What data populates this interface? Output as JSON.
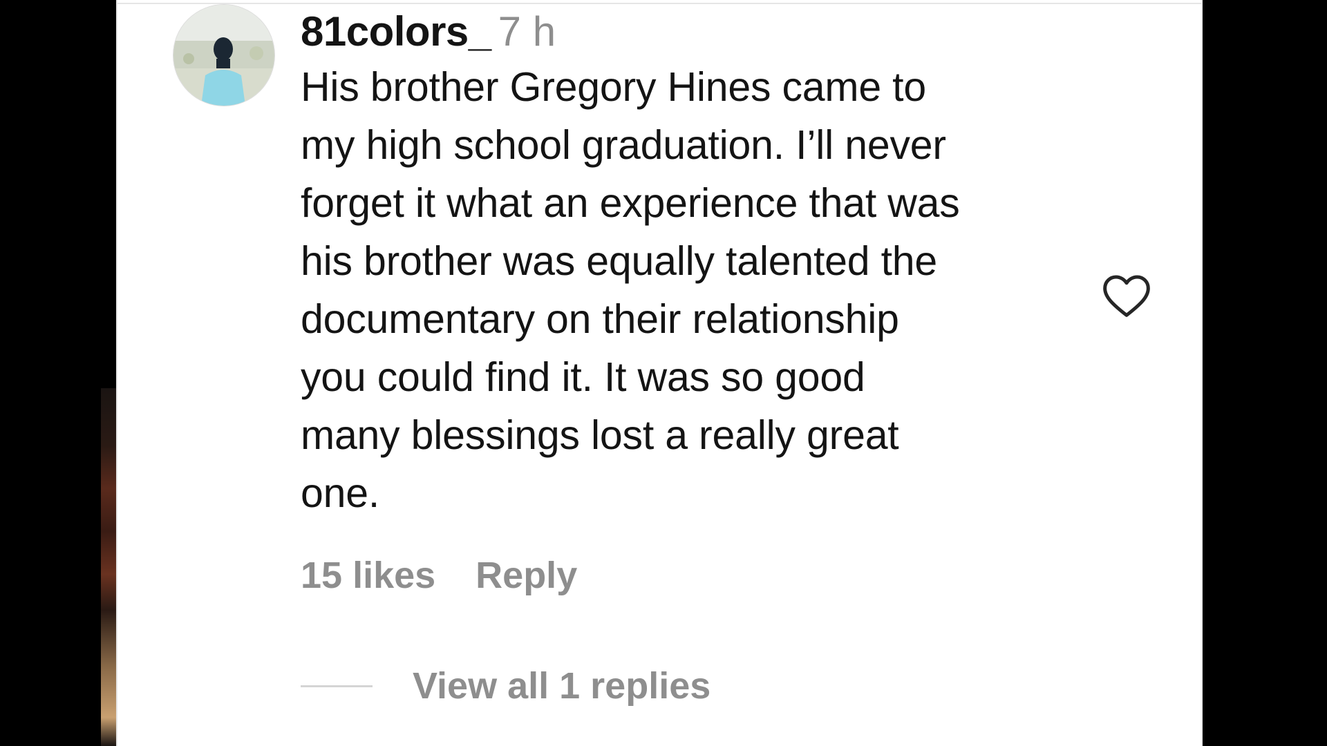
{
  "comment": {
    "username": "81colors_",
    "time": "7 h",
    "lines": [
      "His brother Gregory Hines came to",
      "my high school graduation. I’ll never",
      "forget it what an experience that was",
      "his brother was equally talented the",
      "documentary on their relationship",
      "you could find it. It was so good",
      "many blessings lost a really great",
      "one."
    ],
    "likes": "15 likes",
    "reply_label": "Reply",
    "view_replies": "View all 1 replies"
  },
  "icons": {
    "like": "heart-outline-icon",
    "avatar": "user-avatar"
  },
  "colors": {
    "text": "#141414",
    "muted": "#8e8e8e",
    "background": "#ffffff",
    "frame": "#000000"
  }
}
